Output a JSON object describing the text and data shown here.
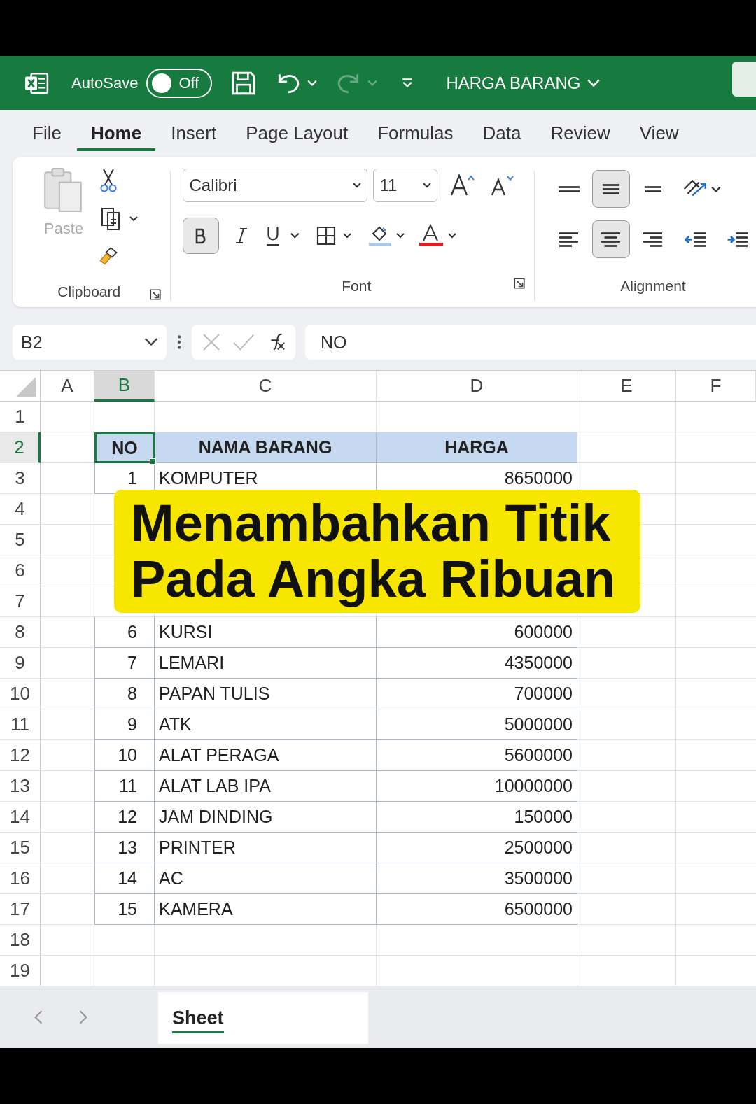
{
  "title_bar": {
    "autosave_label": "AutoSave",
    "autosave": {
      "on": false,
      "label": "Off"
    },
    "redo_disabled": true,
    "document_title": "HARGA BARANG"
  },
  "tabs": [
    {
      "label": "File",
      "selected": false
    },
    {
      "label": "Home",
      "selected": true
    },
    {
      "label": "Insert",
      "selected": false
    },
    {
      "label": "Page Layout",
      "selected": false
    },
    {
      "label": "Formulas",
      "selected": false
    },
    {
      "label": "Data",
      "selected": false
    },
    {
      "label": "Review",
      "selected": false
    },
    {
      "label": "View",
      "selected": false
    }
  ],
  "ribbon": {
    "clipboard": {
      "paste_label": "Paste",
      "group_label": "Clipboard"
    },
    "font": {
      "family": "Calibri",
      "size": "11",
      "bold": true,
      "group_label": "Font"
    },
    "alignment": {
      "group_label": "Alignment",
      "rows": [
        [
          {
            "kind": "top",
            "selected": false
          },
          {
            "kind": "middle",
            "selected": true
          },
          {
            "kind": "bottom",
            "selected": false
          },
          {
            "kind": "orientation",
            "selected": false
          }
        ],
        [
          {
            "kind": "left",
            "selected": false
          },
          {
            "kind": "center",
            "selected": true
          },
          {
            "kind": "right",
            "selected": false
          },
          {
            "kind": "outdent",
            "selected": false
          },
          {
            "kind": "indent",
            "selected": false
          }
        ]
      ]
    }
  },
  "formula_bar": {
    "name_box": "B2",
    "value": "NO"
  },
  "sheet": {
    "columns": [
      {
        "label": "A",
        "selected": false
      },
      {
        "label": "B",
        "selected": true
      },
      {
        "label": "C",
        "selected": false
      },
      {
        "label": "D",
        "selected": false
      },
      {
        "label": "E",
        "selected": false
      },
      {
        "label": "F",
        "selected": false
      }
    ],
    "rows": [
      {
        "number": "1",
        "kind": "blank"
      },
      {
        "number": "2",
        "kind": "header",
        "no": "NO",
        "name": "NAMA BARANG",
        "price": "HARGA"
      },
      {
        "number": "3",
        "kind": "data",
        "no": "1",
        "name": "KOMPUTER",
        "price": "8650000"
      },
      {
        "number": "4",
        "kind": "covered"
      },
      {
        "number": "5",
        "kind": "covered"
      },
      {
        "number": "6",
        "kind": "covered"
      },
      {
        "number": "7",
        "kind": "covered"
      },
      {
        "number": "8",
        "kind": "data",
        "no": "6",
        "name": "KURSI",
        "price": "600000"
      },
      {
        "number": "9",
        "kind": "data",
        "no": "7",
        "name": "LEMARI",
        "price": "4350000"
      },
      {
        "number": "10",
        "kind": "data",
        "no": "8",
        "name": "PAPAN TULIS",
        "price": "700000"
      },
      {
        "number": "11",
        "kind": "data",
        "no": "9",
        "name": "ATK",
        "price": "5000000"
      },
      {
        "number": "12",
        "kind": "data",
        "no": "10",
        "name": "ALAT PERAGA",
        "price": "5600000"
      },
      {
        "number": "13",
        "kind": "data",
        "no": "11",
        "name": "ALAT LAB IPA",
        "price": "10000000"
      },
      {
        "number": "14",
        "kind": "data",
        "no": "12",
        "name": "JAM DINDING",
        "price": "150000"
      },
      {
        "number": "15",
        "kind": "data",
        "no": "13",
        "name": "PRINTER",
        "price": "2500000"
      },
      {
        "number": "16",
        "kind": "data",
        "no": "14",
        "name": "AC",
        "price": "3500000"
      },
      {
        "number": "17",
        "kind": "data",
        "no": "15",
        "name": "KAMERA",
        "price": "6500000"
      },
      {
        "number": "18",
        "kind": "blank"
      },
      {
        "number": "19",
        "kind": "blank"
      }
    ]
  },
  "caption": [
    "Menambahkan Titik",
    "Pada Angka Ribuan"
  ],
  "sheet_tabs": [
    {
      "label": "Sheet",
      "selected": true
    }
  ]
}
